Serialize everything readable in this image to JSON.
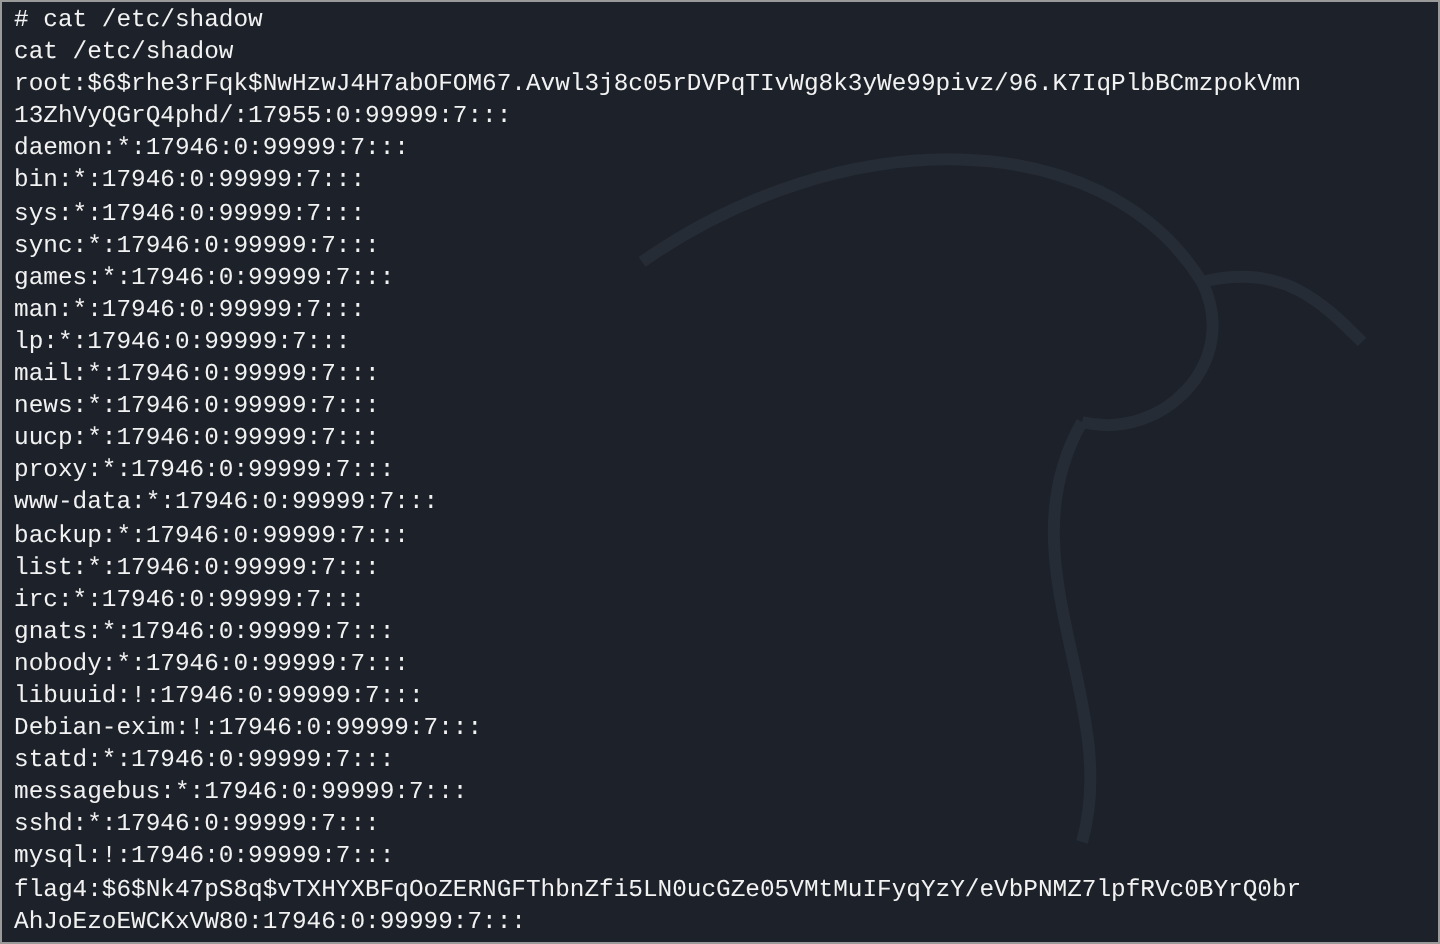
{
  "terminal": {
    "lines": [
      "# cat /etc/shadow",
      "cat /etc/shadow",
      "root:$6$rhe3rFqk$NwHzwJ4H7abOFOM67.Avwl3j8c05rDVPqTIvWg8k3yWe99pivz/96.K7IqPlbBCmzpokVmn",
      "13ZhVyQGrQ4phd/:17955:0:99999:7:::",
      "daemon:*:17946:0:99999:7:::",
      "bin:*:17946:0:99999:7:::",
      "sys:*:17946:0:99999:7:::",
      "sync:*:17946:0:99999:7:::",
      "games:*:17946:0:99999:7:::",
      "man:*:17946:0:99999:7:::",
      "lp:*:17946:0:99999:7:::",
      "mail:*:17946:0:99999:7:::",
      "news:*:17946:0:99999:7:::",
      "uucp:*:17946:0:99999:7:::",
      "proxy:*:17946:0:99999:7:::",
      "www-data:*:17946:0:99999:7:::",
      "backup:*:17946:0:99999:7:::",
      "list:*:17946:0:99999:7:::",
      "irc:*:17946:0:99999:7:::",
      "gnats:*:17946:0:99999:7:::",
      "nobody:*:17946:0:99999:7:::",
      "libuuid:!:17946:0:99999:7:::",
      "Debian-exim:!:17946:0:99999:7:::",
      "statd:*:17946:0:99999:7:::",
      "messagebus:*:17946:0:99999:7:::",
      "sshd:*:17946:0:99999:7:::",
      "mysql:!:17946:0:99999:7:::",
      "flag4:$6$Nk47pS8q$vTXHYXBFqOoZERNGFThbnZfi5LN0ucGZe05VMtMuIFyqYzY/eVbPNMZ7lpfRVc0BYrQ0br",
      "AhJoEzoEWCKxVW80:17946:0:99999:7:::"
    ]
  }
}
